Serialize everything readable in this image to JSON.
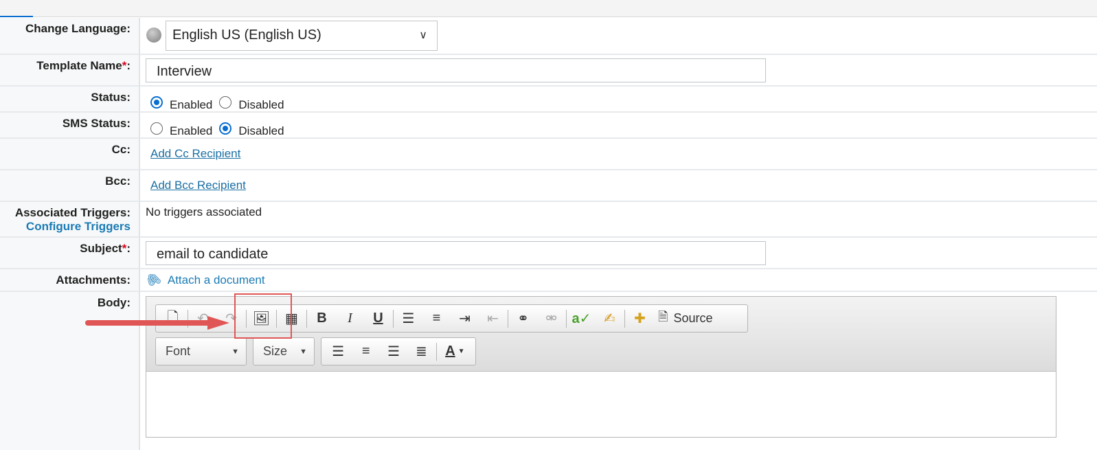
{
  "form": {
    "change_language": {
      "label": "Change Language:",
      "icon": "globe-icon",
      "selected": "English US (English US)"
    },
    "template_name": {
      "label": "Template Name",
      "required_mark": "*",
      "colon": ":",
      "value": "Interview"
    },
    "status": {
      "label": "Status:",
      "options": [
        "Enabled",
        "Disabled"
      ],
      "selected": "Enabled"
    },
    "sms_status": {
      "label": "SMS Status:",
      "options": [
        "Enabled",
        "Disabled"
      ],
      "selected": "Disabled"
    },
    "cc": {
      "label": "Cc:",
      "link": "Add Cc Recipient"
    },
    "bcc": {
      "label": "Bcc:",
      "link": "Add Bcc Recipient"
    },
    "triggers": {
      "label": "Associated Triggers:",
      "configure_link": "Configure Triggers",
      "value": "No triggers associated"
    },
    "subject": {
      "label": "Subject",
      "required_mark": "*",
      "colon": ":",
      "value": "email to candidate"
    },
    "attachments": {
      "label": "Attachments:",
      "link": "Attach a document",
      "icon": "paperclip-icon"
    },
    "body": {
      "label": "Body:"
    }
  },
  "editor": {
    "toolbar_row1": [
      "new-page-icon",
      "undo-icon",
      "redo-icon",
      "image-icon",
      "table-icon",
      "bold-icon",
      "italic-icon",
      "underline-icon",
      "numbered-list-icon",
      "bullet-list-icon",
      "indent-icon",
      "outdent-icon",
      "link-icon",
      "unlink-icon",
      "spellcheck-icon",
      "format-painter-icon",
      "placeholder-icon",
      "source-icon"
    ],
    "bold": "B",
    "italic": "I",
    "underline": "U",
    "source_label": "Source",
    "font_label": "Font",
    "size_label": "Size",
    "text_color_label": "A",
    "toolbar_row2_align": [
      "align-left-icon",
      "align-center-icon",
      "align-right-icon",
      "justify-icon"
    ]
  },
  "colors": {
    "accent": "#0a6ed1",
    "link": "#1a6fa3",
    "required": "#d9001b",
    "annotation": "#e05555"
  }
}
